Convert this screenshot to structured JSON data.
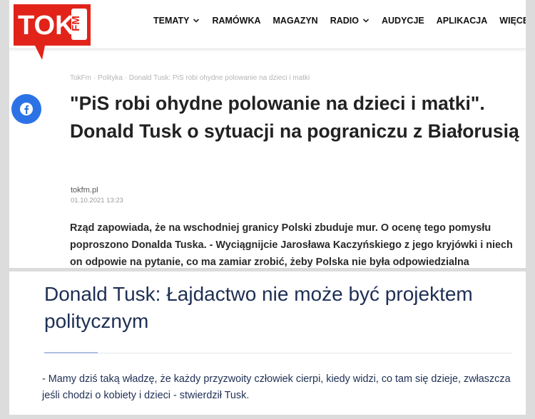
{
  "header": {
    "logo": {
      "text_tok": "TOK",
      "text_fm": "FM",
      "color": "#e2231a"
    },
    "nav": [
      {
        "label": "TEMATY",
        "dropdown": true
      },
      {
        "label": "RAMÓWKA",
        "dropdown": false
      },
      {
        "label": "MAGAZYN",
        "dropdown": false
      },
      {
        "label": "RADIO",
        "dropdown": true
      },
      {
        "label": "AUDYCJE",
        "dropdown": false
      },
      {
        "label": "APLIKACJA",
        "dropdown": false
      },
      {
        "label": "WIĘCEJ",
        "dropdown": true
      }
    ]
  },
  "article": {
    "breadcrumb": "TokFm · Polityka · Donald Tusk: PiS robi ohydne polowanie na dzieci i matki",
    "share_icon": "facebook-icon",
    "share_color": "#2b72e6",
    "headline": "\"PiS robi ohydne polowanie na dzieci i matki\". Donald Tusk o sytuacji na pograniczu z Białorusią",
    "author": "tokfm.pl",
    "date": "01.10.2021 13:23",
    "lead": "Rząd zapowiada, że na wschodniej granicy Polski zbuduje mur. O ocenę tego pomysłu poproszono Donalda Tuska. - Wyciągnijcie Jarosława Kaczyńskiego z jego kryjówki i niech on odpowie na pytanie, co ma zamiar zrobić, żeby Polska nie była odpowiedzialna"
  },
  "second_article": {
    "title": "Donald Tusk: Łajdactwo nie może być projektem politycznym",
    "body": "- Mamy dziś taką władzę, że każdy przyzwoity człowiek cierpi, kiedy widzi, co tam się dzieje, zwłaszcza jeśli chodzi o kobiety i dzieci - stwierdził Tusk.",
    "accent_color": "#1e2f54"
  }
}
